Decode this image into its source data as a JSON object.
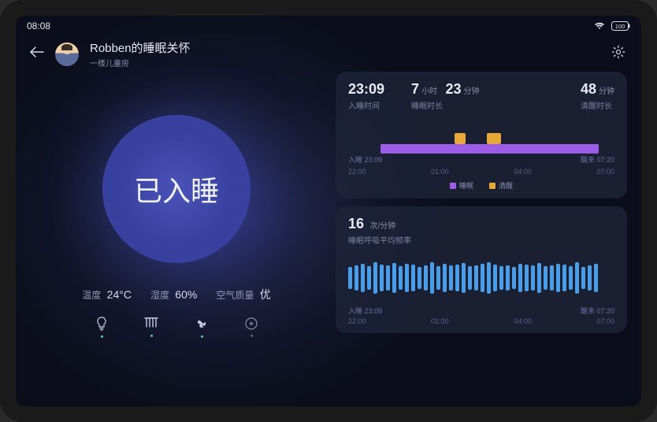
{
  "status_bar": {
    "time": "08:08",
    "battery": "100"
  },
  "header": {
    "title": "Robben的睡眠关怀",
    "subtitle": "一楼儿童房"
  },
  "sleep_status": "已入睡",
  "env": {
    "temp_label": "温度",
    "temp_val": "24°C",
    "humidity_label": "湿度",
    "humidity_val": "60%",
    "air_label": "空气质量",
    "air_val": "优"
  },
  "sleep_card": {
    "bedtime_val": "23:09",
    "bedtime_label": "入睡时间",
    "duration_h": "7",
    "duration_h_unit": "小时",
    "duration_m": "23",
    "duration_m_unit": "分钟",
    "duration_label": "睡眠时长",
    "awake_val": "48",
    "awake_unit": "分钟",
    "awake_label": "清醒时长",
    "start_marker_prefix": "入睡",
    "start_marker_time": "23:09",
    "end_marker_prefix": "醒来",
    "end_marker_time": "07:20",
    "legend_sleep": "睡眠",
    "legend_awake": "清醒"
  },
  "breath_card": {
    "val": "16",
    "unit": "次/分钟",
    "label": "睡眠呼吸平均频率",
    "start_marker_prefix": "入睡",
    "start_marker_time": "23:09",
    "end_marker_prefix": "醒来",
    "end_marker_time": "07:20"
  },
  "chart_data": [
    {
      "type": "bar",
      "title": "睡眠时段",
      "x_ticks": [
        "22:00",
        "01:00",
        "04:00",
        "07:00"
      ],
      "start_time": "23:09",
      "end_time": "07:20",
      "series": [
        {
          "name": "睡眠",
          "segments": [
            [
              "23:09",
              "07:20"
            ]
          ]
        },
        {
          "name": "清醒",
          "segments": [
            [
              "02:00",
              "02:20"
            ],
            [
              "03:05",
              "03:30"
            ]
          ]
        }
      ],
      "legend": [
        "睡眠",
        "清醒"
      ]
    },
    {
      "type": "bar",
      "title": "睡眠呼吸平均频率",
      "unit": "次/分钟",
      "x_ticks": [
        "22:00",
        "01:00",
        "04:00",
        "07:00"
      ],
      "start_time": "23:09",
      "end_time": "07:20",
      "values": [
        14,
        16,
        18,
        15,
        20,
        17,
        16,
        19,
        15,
        18,
        17,
        14,
        16,
        20,
        15,
        18,
        16,
        17,
        19,
        15,
        16,
        18,
        20,
        17,
        15,
        16,
        14,
        18,
        17,
        16,
        19,
        15,
        16,
        18,
        17,
        15,
        20,
        14,
        16,
        18
      ]
    }
  ],
  "axis_ticks": [
    "22:00",
    "01:00",
    "04:00",
    "07:00"
  ],
  "colors": {
    "sleep": "#9d5ce8",
    "awake": "#e8a838",
    "breath": "#4a9de8"
  }
}
